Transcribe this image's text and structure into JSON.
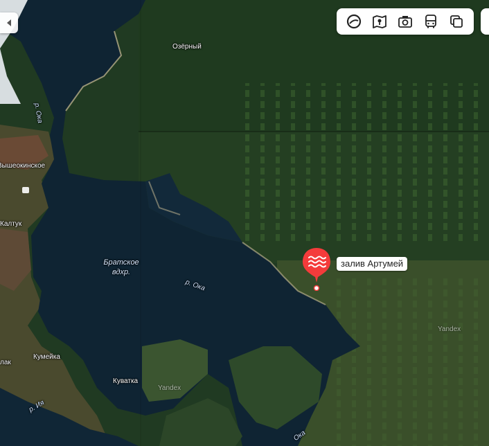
{
  "map": {
    "places": {
      "ozerny": "Озёрный",
      "vysheokinskoe": "Вышеокинское",
      "kaltuk": "Калтук",
      "kumeyka": "Кумейка",
      "kuvatka": "Куватка",
      "lak": "лак"
    },
    "water": {
      "reservoir": "Братское вдхр.",
      "oka_north": "р. Ока",
      "oka_middle": "р. Ока",
      "oka_south": "Ока",
      "iya": "р. Ия"
    },
    "watermarks": {
      "center": "Yandex",
      "right": "Yandex"
    },
    "marker": {
      "label": "залив Артумей",
      "icon": "water-bay-icon",
      "color": "#f43b3b"
    }
  },
  "toolbar": {
    "buttons": [
      {
        "icon": "alice-circle-icon"
      },
      {
        "icon": "panorama-map-icon"
      },
      {
        "icon": "camera-photos-icon"
      },
      {
        "icon": "bus-transport-icon"
      },
      {
        "icon": "layers-icon"
      }
    ]
  },
  "controls": {
    "collapse_icon": "triangle-left-icon"
  }
}
